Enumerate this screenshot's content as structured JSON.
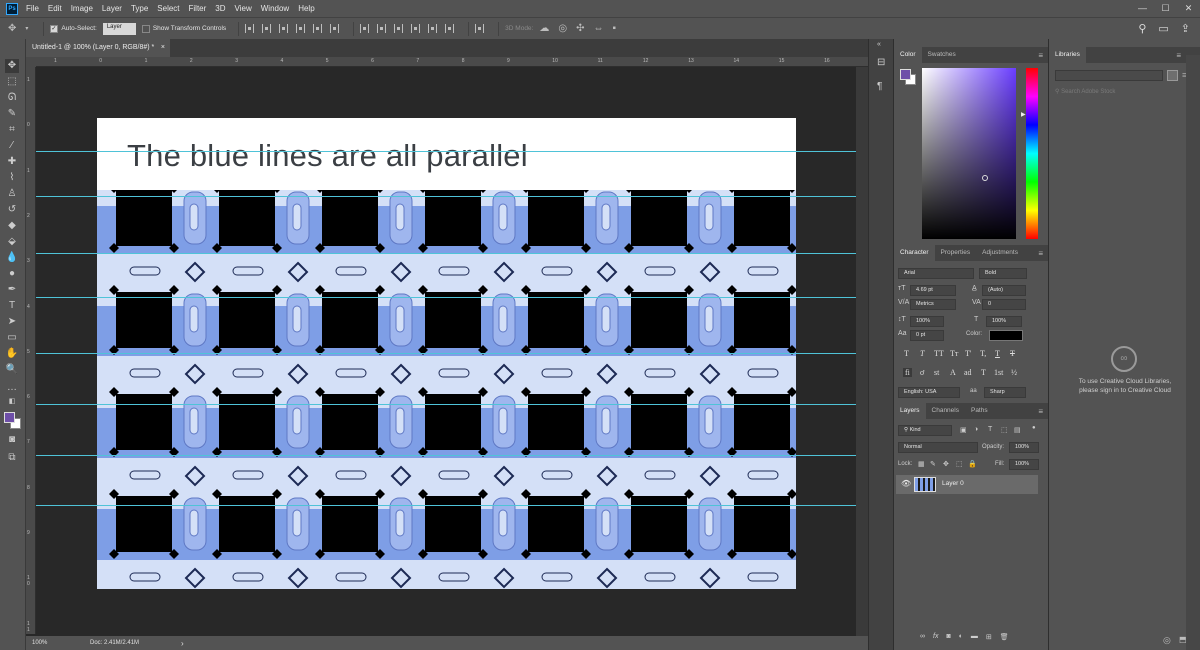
{
  "menubar": {
    "app_icon": "Ps",
    "items": [
      "File",
      "Edit",
      "Image",
      "Layer",
      "Type",
      "Select",
      "Filter",
      "3D",
      "View",
      "Window",
      "Help"
    ],
    "window_controls": [
      "minimize-icon",
      "maximize-icon",
      "close-icon"
    ]
  },
  "options_bar": {
    "auto_select_label": "Auto-Select:",
    "auto_select_value": "Layer",
    "show_transform_label": "Show Transform Controls",
    "mode_3d_label": "3D Mode:",
    "auto_select_checked": true,
    "show_transform_checked": false
  },
  "document_tab": {
    "title": "Untitled-1 @ 100% (Layer 0, RGB/8#) *",
    "close": "×"
  },
  "ruler_h_labels": [
    "1",
    "0",
    "1",
    "2",
    "3",
    "4",
    "5",
    "6",
    "7",
    "8",
    "9",
    "10",
    "11",
    "12",
    "13",
    "14",
    "15",
    "16"
  ],
  "ruler_v_labels": [
    "1",
    "0",
    "1",
    "2",
    "3",
    "4",
    "5",
    "6",
    "7",
    "8",
    "9",
    "1 0",
    "1 1"
  ],
  "canvas": {
    "headline": "The blue lines are all parallel",
    "guide_color": "#4fc3d8",
    "pattern_blue": "#7e9ee6",
    "pattern_light": "#d4e0f7",
    "pattern_dark": "#000000"
  },
  "status": {
    "zoom": "100%",
    "doc": "Doc: 2.41M/2.41M",
    "arrow": "›"
  },
  "color_panel": {
    "tabs": [
      "Color",
      "Swatches"
    ],
    "foreground": "#6e4fa8",
    "background": "#ffffff"
  },
  "character_panel": {
    "tabs": [
      "Character",
      "Properties",
      "Adjustments"
    ],
    "font_family": "Arial",
    "font_style": "Bold",
    "font_size": "4.69 pt",
    "leading": "(Auto)",
    "kerning": "Metrics",
    "tracking": "0",
    "vertical_scale": "100%",
    "horizontal_scale": "100%",
    "baseline_shift": "0 pt",
    "color_label": "Color:",
    "language": "English: USA",
    "antialias_label": "aa",
    "antialias": "Sharp",
    "type_buttons": [
      "T",
      "T",
      "TT",
      "Tт",
      "T'",
      "T,",
      "T",
      "T"
    ],
    "opentype_buttons": [
      "fi",
      "ơ",
      "st",
      "A",
      "ad",
      "T",
      "1st",
      "½"
    ]
  },
  "layers_panel": {
    "tabs": [
      "Layers",
      "Channels",
      "Paths"
    ],
    "filter_kind": "Kind",
    "blend_mode": "Normal",
    "opacity_label": "Opacity:",
    "opacity": "100%",
    "lock_label": "Lock:",
    "fill_label": "Fill:",
    "fill": "100%",
    "layers": [
      {
        "name": "Layer 0",
        "visible": true
      }
    ],
    "bottom_icons": [
      "link-icon",
      "fx-icon",
      "mask-icon",
      "adjustment-icon",
      "folder-icon",
      "new-layer-icon",
      "trash-icon"
    ]
  },
  "libraries_panel": {
    "tab": "Libraries",
    "search_placeholder": "Search Adobe Stock",
    "message": "To use Creative Cloud Libraries, please sign in to Creative Cloud"
  }
}
